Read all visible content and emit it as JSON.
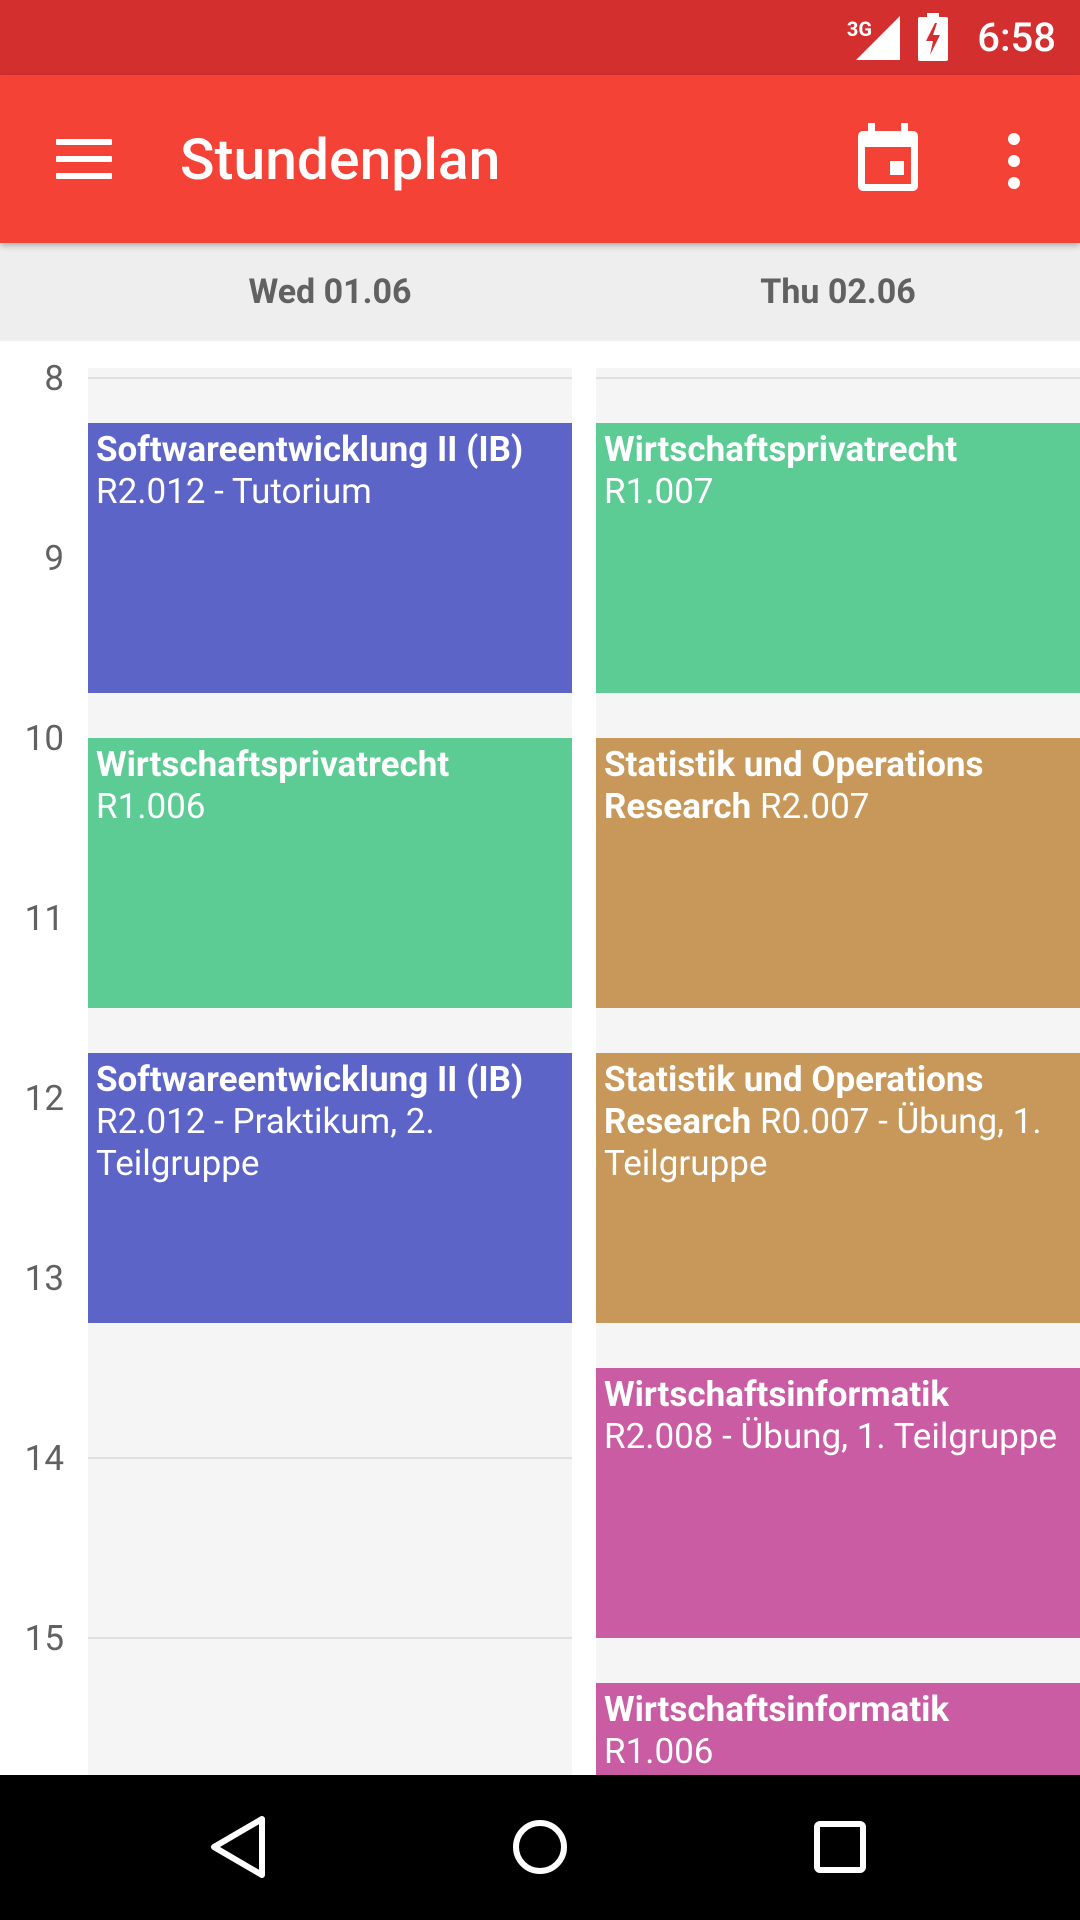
{
  "status_bar": {
    "network": "3G",
    "time": "6:58"
  },
  "app_bar": {
    "title": "Stundenplan"
  },
  "days": [
    {
      "label": "Wed 01.06"
    },
    {
      "label": "Thu 02.06"
    }
  ],
  "hours": [
    "8",
    "9",
    "10",
    "11",
    "12",
    "13",
    "14",
    "15"
  ],
  "events": {
    "wed": [
      {
        "title": "Softwareentwicklung II (IB)",
        "detail": "R2.012 - Tutorium"
      },
      {
        "title": "Wirtschaftsprivatrecht",
        "detail": "R1.006"
      },
      {
        "title": "Softwareentwicklung II (IB)",
        "detail": "R2.012 - Praktikum, 2. Teilgruppe"
      }
    ],
    "thu": [
      {
        "title": "Wirtschaftsprivatrecht",
        "detail": "R1.007"
      },
      {
        "title": "Statistik und Operations Research",
        "detail": "R2.007"
      },
      {
        "title": "Statistik und Operations Research",
        "detail": "R0.007 - Übung, 1. Teilgruppe"
      },
      {
        "title": "Wirtschaftsinformatik",
        "detail": "R2.008 - Übung, 1. Teilgruppe"
      },
      {
        "title": "Wirtschaftsinformatik",
        "detail": "R1.006"
      }
    ]
  },
  "colors": {
    "status_bar": "#d32f2f",
    "app_bar": "#f44336",
    "softwareentwicklung": "#5c64c8",
    "wirtschaftsprivatrecht": "#5ccb94",
    "statistik": "#c8985a",
    "wirtschaftsinformatik": "#c95ca2"
  },
  "nav_bar": {
    "back": "back-icon",
    "home": "home-icon",
    "recents": "recents-icon"
  }
}
